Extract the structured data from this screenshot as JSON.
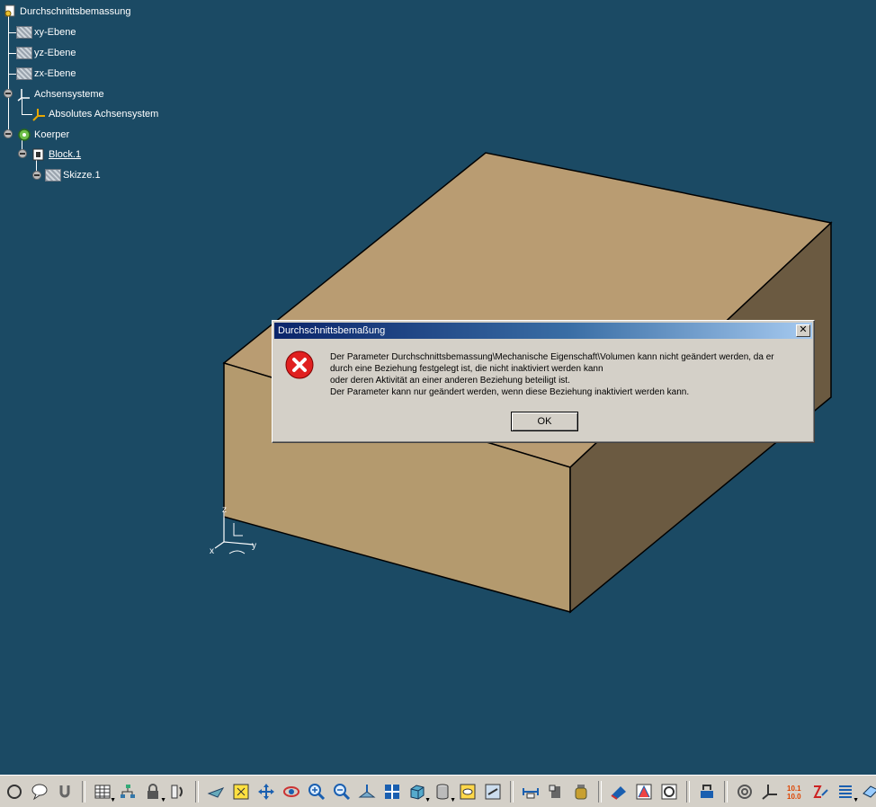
{
  "tree": {
    "root": "Durchschnittsbemassung",
    "xy": "xy-Ebene",
    "yz": "yz-Ebene",
    "zx": "zx-Ebene",
    "axes_group": "Achsensysteme",
    "axes_abs": "Absolutes Achsensystem",
    "body": "Koerper",
    "block": "Block.1",
    "sketch": "Skizze.1"
  },
  "dialog": {
    "title": "Durchschnittsbemaßung",
    "close": "✕",
    "line1": "Der Parameter Durchschnittsbemassung\\Mechanische Eigenschaft\\Volumen kann nicht geändert werden, da er",
    "line2": "durch eine Beziehung festgelegt ist, die nicht inaktiviert werden kann",
    "line3": "oder deren Aktivität an einer anderen Beziehung beteiligt ist.",
    "line4": "Der Parameter kann nur geändert werden, wenn diese Beziehung inaktiviert werden kann.",
    "ok": "OK"
  },
  "axis": {
    "x": "x",
    "y": "y",
    "z": "z"
  },
  "colors": {
    "background": "#1b4a64",
    "box_top": "#b99c72",
    "box_front": "#b49a6e",
    "box_side": "#6b5a41"
  },
  "toolbar": {
    "icons": [
      "compass-icon",
      "bubble-icon",
      "magnet-icon",
      "table-icon",
      "tree-icon",
      "lock-icon",
      "catalog-icon",
      "fly-icon",
      "fit-all-icon",
      "pan-icon",
      "rotate-icon",
      "zoom-in-icon",
      "zoom-out-icon",
      "normal-view-icon",
      "multi-view-icon",
      "iso-view-icon",
      "render-style-icon",
      "hide-show-icon",
      "swap-icon",
      "measure-icon",
      "inertia-icon",
      "material-icon",
      "sketch-icon",
      "knowledge-icon",
      "formula-icon",
      "transform-icon",
      "snap-icon",
      "axis-system-icon",
      "param-icon",
      "rules-icon",
      "list-icon",
      "plane-icon"
    ]
  }
}
